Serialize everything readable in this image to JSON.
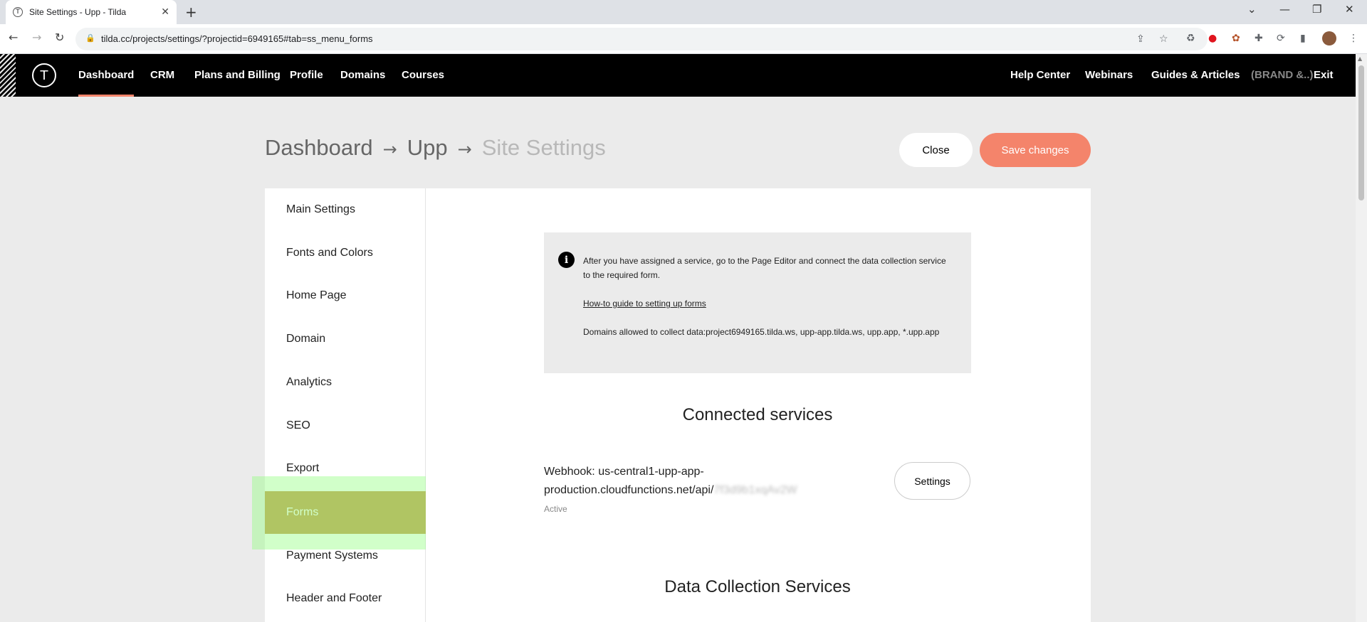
{
  "browser": {
    "tab_title": "Site Settings - Upp - Tilda",
    "tab_close": "✕",
    "new_tab": "+",
    "url": "tilda.cc/projects/settings/?projectid=6949165#tab=ss_menu_forms",
    "back": "←",
    "forward": "→",
    "reload": "↻",
    "lock": "🔒",
    "share": "⇪",
    "star": "☆",
    "ext_recycle": "♻",
    "ext_opera": "●",
    "ext_bug": "✿",
    "ext_puzzle": "✚",
    "ext_sync": "⟳",
    "ext_panel": "▮",
    "menu": "⋮",
    "win_min": "—",
    "win_restore": "❐",
    "win_close": "✕",
    "win_chevron": "⌄"
  },
  "nav": {
    "logo": "T",
    "items": [
      "Dashboard",
      "CRM",
      "Plans and Billing",
      "Profile",
      "Domains",
      "Courses"
    ],
    "right": [
      "Help Center",
      "Webinars",
      "Guides & Articles"
    ],
    "brand": "(BRAND &..)",
    "exit": "Exit",
    "accent_color": "#f4846b"
  },
  "header": {
    "crumbs": [
      "Dashboard",
      "Upp",
      "Site Settings"
    ],
    "arrow": "→",
    "close_label": "Close",
    "save_label": "Save changes"
  },
  "sidebar": {
    "items": [
      "Main Settings",
      "Fonts and Colors",
      "Home Page",
      "Domain",
      "Analytics",
      "SEO",
      "Export",
      "Forms",
      "Payment Systems",
      "Header and Footer"
    ],
    "active": "Forms",
    "active_color": "#c89f55"
  },
  "info": {
    "icon": "i",
    "text1": "After you have assigned a service, go to the Page Editor and connect the data collection service to the required form.",
    "guide_link": "How-to guide to setting up forms",
    "domains_text": "Domains allowed to collect data:project6949165.tilda.ws, upp-app.tilda.ws, upp.app, *.upp.app"
  },
  "connected": {
    "title": "Connected services",
    "service_label": "Webhook: us-central1-upp-app-production.cloudfunctions.net/api/",
    "service_blurred": "7f3d9b1xqAv2W",
    "status": "Active",
    "settings_label": "Settings"
  },
  "data_collection": {
    "title": "Data Collection Services"
  }
}
